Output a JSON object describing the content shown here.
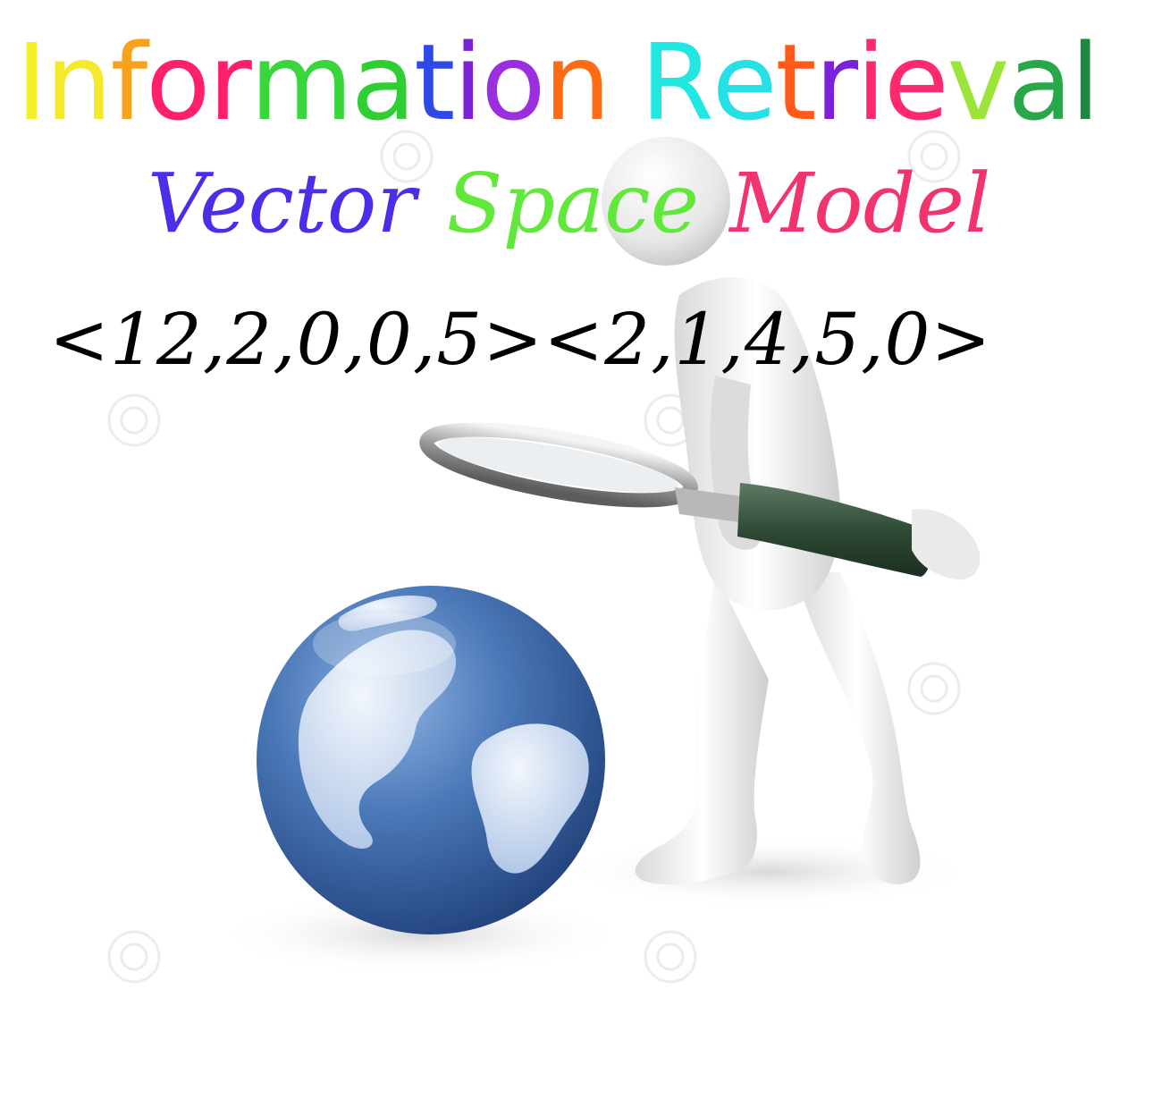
{
  "title": {
    "letters": [
      {
        "ch": "I",
        "color": "#f4ef2a"
      },
      {
        "ch": "n",
        "color": "#f6e92b"
      },
      {
        "ch": "f",
        "color": "#f7a21c"
      },
      {
        "ch": "o",
        "color": "#ff1f6c"
      },
      {
        "ch": "r",
        "color": "#ff1f6c"
      },
      {
        "ch": "m",
        "color": "#38d63a"
      },
      {
        "ch": "a",
        "color": "#2fcf34"
      },
      {
        "ch": "t",
        "color": "#2f49e6"
      },
      {
        "ch": "i",
        "color": "#7b22d6"
      },
      {
        "ch": "o",
        "color": "#9b2fe0"
      },
      {
        "ch": "n",
        "color": "#ff6b12"
      },
      {
        "ch": " ",
        "color": "#ffffff"
      },
      {
        "ch": "R",
        "color": "#20e8e0"
      },
      {
        "ch": "e",
        "color": "#25e0e4"
      },
      {
        "ch": "t",
        "color": "#ff5a1a"
      },
      {
        "ch": "r",
        "color": "#7a22d8"
      },
      {
        "ch": "i",
        "color": "#ff2a6e"
      },
      {
        "ch": "e",
        "color": "#ff2a6e"
      },
      {
        "ch": "v",
        "color": "#9ce33a"
      },
      {
        "ch": "a",
        "color": "#29a84a"
      },
      {
        "ch": "l",
        "color": "#1a8a3f"
      }
    ]
  },
  "subtitle": {
    "words": [
      {
        "text": "Vector",
        "color": "#4a2ee8"
      },
      {
        "text": "Space",
        "color": "#62e83a"
      },
      {
        "text": "Model",
        "color": "#f2346e"
      }
    ]
  },
  "vectors": {
    "text": "<12,2,0,0,5><2,1,4,5,0>"
  },
  "illustration": {
    "figure": "3d-person-with-magnifying-glass",
    "globe": "blue-earth-globe",
    "watermark": "dreamstime"
  }
}
